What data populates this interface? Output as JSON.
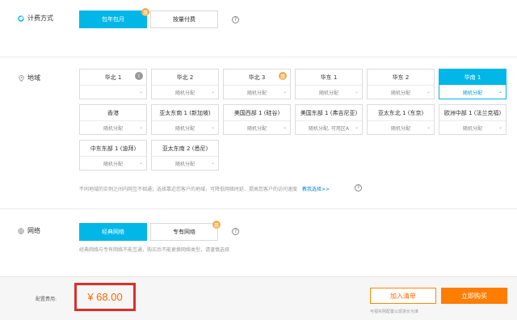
{
  "billing": {
    "label": "计费方式",
    "options": [
      {
        "label": "包年包月"
      },
      {
        "label": "按量付费"
      }
    ],
    "help": "?"
  },
  "region": {
    "label": "地域",
    "cards": [
      {
        "name": "华北 1",
        "zone": ""
      },
      {
        "name": "华北 2",
        "zone": "随机分配"
      },
      {
        "name": "华北 3",
        "zone": "随机分配"
      },
      {
        "name": "华东 1",
        "zone": "随机分配"
      },
      {
        "name": "华东 2",
        "zone": "随机分配"
      },
      {
        "name": "华南 1",
        "zone": "随机分配"
      },
      {
        "name": "香港",
        "zone": "随机分配"
      },
      {
        "name": "亚太东南 1 (新加坡)",
        "zone": "随机分配"
      },
      {
        "name": "美国西部 1 (硅谷)",
        "zone": "随机分配"
      },
      {
        "name": "美国东部 1 (弗吉尼亚)",
        "zone": "随机分配, 可用区A"
      },
      {
        "name": "亚太东北 1 (东京)",
        "zone": "随机分配"
      },
      {
        "name": "欧洲中部 1 (法兰克福)",
        "zone": "随机分配"
      },
      {
        "name": "中东东部 1 (迪拜)",
        "zone": "随机分配"
      },
      {
        "name": "亚太东南 2 (悉尼)",
        "zone": "随机分配"
      }
    ],
    "note": "不同地域的实例之间内网互不相通；选择靠近您客户的地域，可降低网络时延、提高您客户的访问速度",
    "note_link": "教我选择>>",
    "help": "?"
  },
  "network": {
    "label": "网络",
    "options": [
      {
        "label": "经典网络"
      },
      {
        "label": "专有网络"
      }
    ],
    "note": "经典网络与专有网络不能互通，购买后不能更换网络类型，请谨慎选择",
    "help": "?"
  },
  "footer": {
    "fee_label": "配置费用:",
    "price": "¥ 68.00",
    "cart_button": "加入清单",
    "buy_button": "立即购买",
    "note": "可视实例配置以现货价为准"
  },
  "colors": {
    "accent": "#00b7e8",
    "price": "#ff6a00",
    "buy": "#ff7d00",
    "highlight_border": "#d9312b"
  }
}
